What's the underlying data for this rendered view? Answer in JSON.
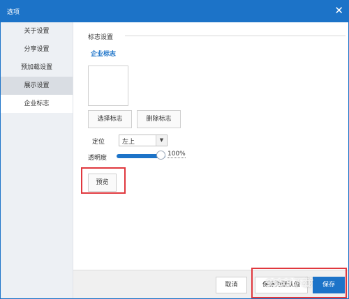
{
  "window": {
    "title": "选项",
    "close_glyph": "✕"
  },
  "sidebar": {
    "items": [
      {
        "label": "关于设置"
      },
      {
        "label": "分享设置"
      },
      {
        "label": "预加载设置"
      },
      {
        "label": "展示设置"
      },
      {
        "label": "企业标志"
      }
    ]
  },
  "main": {
    "section_title": "标志设置",
    "subsection_title": "企业标志",
    "select_logo_label": "选择标志",
    "delete_logo_label": "删除标志",
    "position_label": "定位",
    "position_value": "左上",
    "opacity_label": "透明度",
    "opacity_value": "100%",
    "opacity_level": 1.0,
    "preview_label": "预览"
  },
  "footer": {
    "cancel_label": "取消",
    "save_default_label": "保存为默认值",
    "save_label": "保存"
  },
  "colors": {
    "accent": "#1c73c8",
    "annotation": "#e0383e"
  },
  "watermark": "9553下载"
}
